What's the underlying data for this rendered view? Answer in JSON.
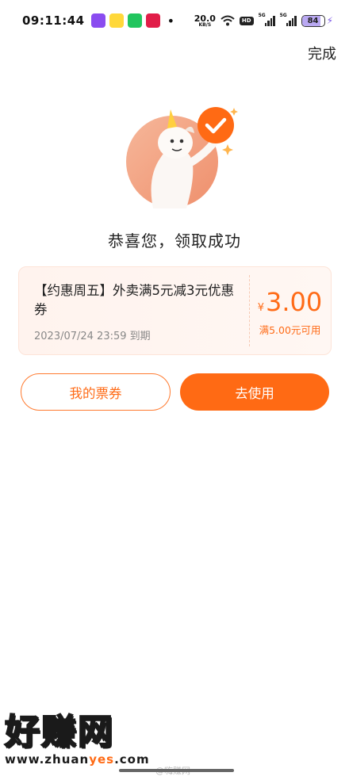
{
  "status_bar": {
    "time": "09:11:44",
    "net_speed_value": "20.0",
    "net_speed_unit": "KB/S",
    "hd_badge": "HD",
    "signal_1_label": "5G",
    "signal_2_label": "5G",
    "battery_level": "84",
    "app_icons": [
      "purple-app-icon",
      "yellow-app-icon",
      "green-app-icon",
      "red-app-icon"
    ]
  },
  "header": {
    "done_label": "完成"
  },
  "success": {
    "title": "恭喜您，领取成功"
  },
  "coupon": {
    "title": "【约惠周五】外卖满5元减3元优惠券",
    "expiry": "2023/07/24 23:59 到期",
    "currency": "¥",
    "amount": "3.00",
    "condition": "满5.00元可用"
  },
  "actions": {
    "my_tickets_label": "我的票券",
    "use_label": "去使用"
  },
  "watermark": {
    "brand": "好赚网",
    "url_prefix": "www.zhuan",
    "url_highlight": "yes",
    "url_suffix": ".com",
    "weibo": "@嗨赚网"
  },
  "colors": {
    "accent": "#ff6a14",
    "coupon_bg": "#fff3ee"
  }
}
